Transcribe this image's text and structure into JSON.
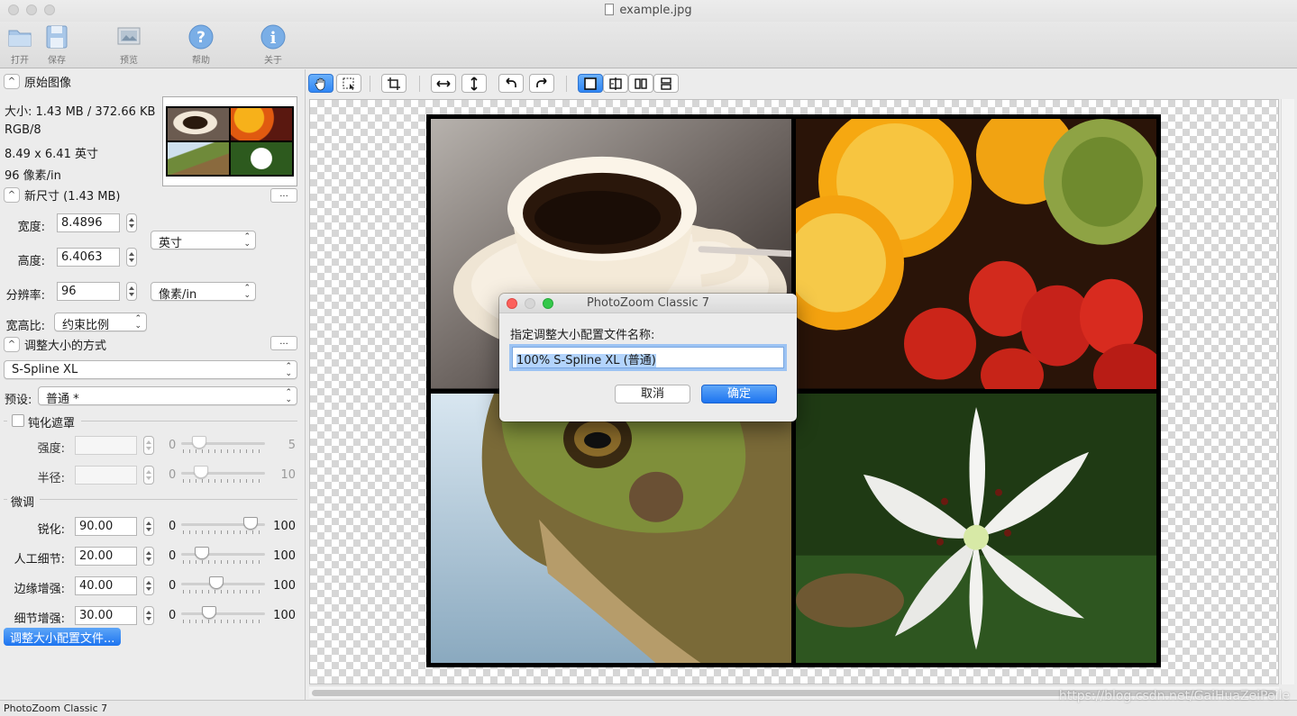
{
  "window": {
    "title": "example.jpg",
    "status": "PhotoZoom Classic 7",
    "watermark": "https://blog.csdn.net/GaiHuaZeiPeile"
  },
  "toolbar": {
    "open": "打开",
    "save": "保存",
    "preview": "预览",
    "help": "帮助",
    "about": "关于"
  },
  "original": {
    "title": "原始图像",
    "size": "大小: 1.43 MB / 372.66 KB",
    "color": "RGB/8",
    "dims": "8.49 x 6.41 英寸",
    "resolution": "96 像素/in"
  },
  "newsize": {
    "title": "新尺寸 (1.43 MB)",
    "more": "...",
    "width_label": "宽度:",
    "width_value": "8.4896",
    "height_label": "高度:",
    "height_value": "6.4063",
    "unit": "英寸",
    "res_label": "分辨率:",
    "res_value": "96",
    "res_unit": "像素/in",
    "aspect_label": "宽高比:",
    "aspect_value": "约束比例"
  },
  "method": {
    "title": "调整大小的方式",
    "more": "...",
    "algorithm": "S-Spline XL",
    "preset_label": "预设:",
    "preset_value": "普通 *"
  },
  "unsharp": {
    "title": "钝化遮罩",
    "strength_label": "强度:",
    "strength_min": "0",
    "strength_max": "5",
    "strength_level": 0.15,
    "radius_label": "半径:",
    "radius_min": "0",
    "radius_max": "10",
    "radius_level": 0.18
  },
  "finetune": {
    "title": "微调",
    "rows": [
      {
        "label": "锐化:",
        "value": "90.00",
        "min": "0",
        "max": "100",
        "level": 0.9
      },
      {
        "label": "人工细节:",
        "value": "20.00",
        "min": "0",
        "max": "100",
        "level": 0.2
      },
      {
        "label": "边缘增强:",
        "value": "40.00",
        "min": "0",
        "max": "100",
        "level": 0.4
      },
      {
        "label": "细节增强:",
        "value": "30.00",
        "min": "0",
        "max": "100",
        "level": 0.3
      }
    ],
    "profile_button": "调整大小配置文件..."
  },
  "dialog": {
    "title": "PhotoZoom Classic 7",
    "prompt": "指定调整大小配置文件名称:",
    "input_value": "100% S-Spline XL (普通)",
    "cancel": "取消",
    "ok": "确定"
  },
  "colors": {
    "accent": "#1d74f0",
    "checker": "#d6d6d6"
  }
}
